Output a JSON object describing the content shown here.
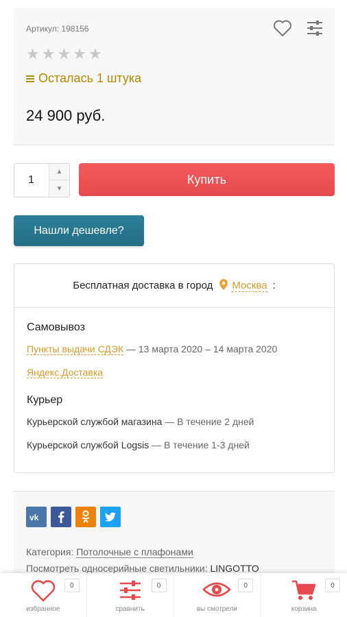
{
  "product": {
    "sku": "Артикул: 198156",
    "rating_stars": [
      "★",
      "★",
      "★",
      "★",
      "★"
    ],
    "stock": "Осталась 1 штука",
    "price": "24 900 руб."
  },
  "purchase": {
    "quantity": "1",
    "buy_label": "Купить",
    "cheaper_label": "Нашли дешевле?"
  },
  "delivery": {
    "free_text": "Бесплатная доставка в город",
    "city": "Москва",
    "colon": ":",
    "pickup_title": "Самовывоз",
    "pickup_rows": [
      {
        "link": "Пункты выдачи СДЭК",
        "detail": " — 13 марта 2020 – 14 марта 2020"
      },
      {
        "link": "Яндекс.Доставка",
        "detail": ""
      }
    ],
    "courier_title": "Курьер",
    "courier_rows": [
      {
        "name": "Курьерской службой магазина",
        "detail": " — В течение 2 дней"
      },
      {
        "name": "Курьерской службой Logsis",
        "detail": " — В течение 1-3 дней"
      }
    ]
  },
  "info": {
    "socials": [
      {
        "label": "vk",
        "color": "#4a76a8",
        "icon": "vk-icon"
      },
      {
        "label": "f",
        "color": "#3b5998",
        "icon": "facebook-icon"
      },
      {
        "label": "ok",
        "color": "#ee8208",
        "icon": "odnoklassniki-icon"
      },
      {
        "label": "tw",
        "color": "#1da1f2",
        "icon": "twitter-icon"
      }
    ],
    "category_label": "Категория: ",
    "category_link": "Потолочные с плафонами",
    "series_label": "Посмотреть односерийные светильники: ",
    "series_value": "LINGOTTO"
  },
  "nav": [
    {
      "label": "избранное",
      "count": "0",
      "icon": "heart-icon"
    },
    {
      "label": "сравнить",
      "count": "0",
      "icon": "compare-icon"
    },
    {
      "label": "вы смотрели",
      "count": "0",
      "icon": "eye-icon"
    },
    {
      "label": "корзина",
      "count": "0",
      "icon": "cart-icon"
    }
  ],
  "colors": {
    "accent_red": "#f25b5e",
    "accent_teal": "#2d7f98",
    "accent_orange": "#d89a2b",
    "stock_gold": "#b48a00"
  }
}
